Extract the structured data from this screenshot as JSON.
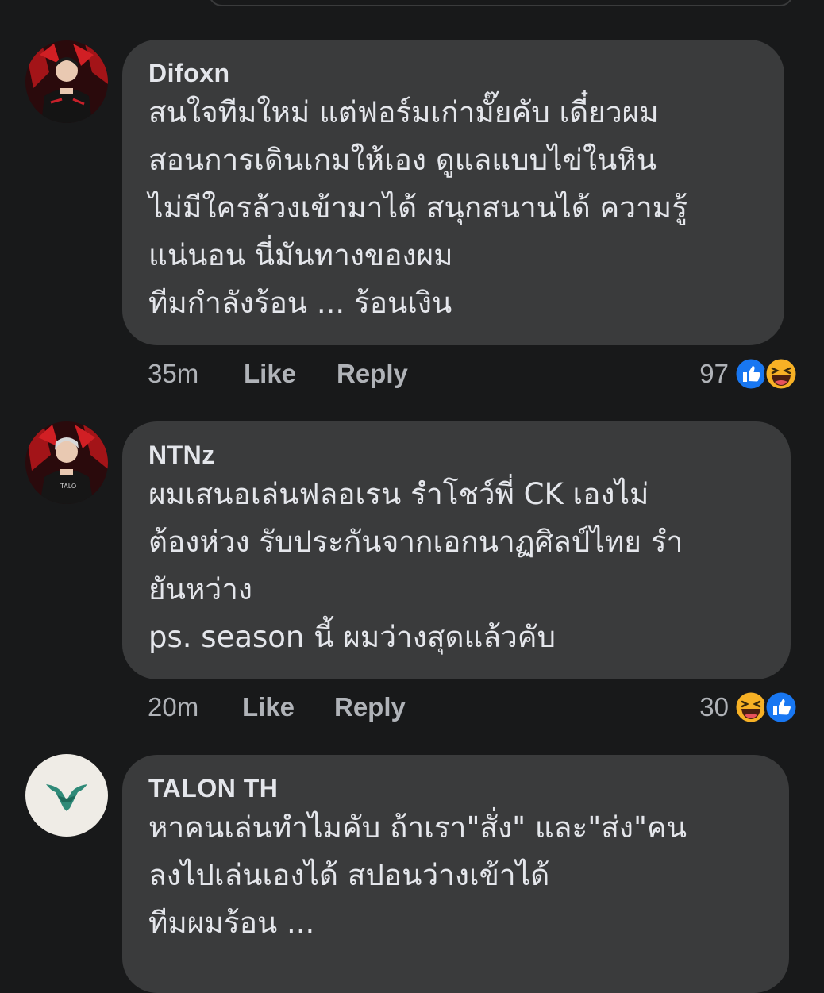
{
  "comments": [
    {
      "author": "Difoxn",
      "lines": [
        "สนใจทีมใหม่ แต่ฟอร์มเก่ามั๊ยคับ เดี๋ยวผม",
        "สอนการเดินเกมให้เอง ดูแลแบบไข่ในหิน",
        "ไม่มีใครล้วงเข้ามาได้ สนุกสนานได้ ความรู้",
        "แน่นอน นี่มันทางของผม",
        "ทีมกำลังร้อน ... ร้อนเงิน"
      ],
      "time": "35m",
      "like_label": "Like",
      "reply_label": "Reply",
      "reaction_count": "97",
      "reactions": [
        "like-icon",
        "haha-icon"
      ]
    },
    {
      "author": "NTNz",
      "lines": [
        "ผมเสนอเล่นฟลอเรน รำโชว์พี่ CK เองไม่",
        "ต้องห่วง รับประกันจากเอกนาฏศิลป์ไทย รำ",
        "ยันหว่าง",
        "ps. season นี้ ผมว่างสุดแล้วคับ"
      ],
      "time": "20m",
      "like_label": "Like",
      "reply_label": "Reply",
      "reaction_count": "30",
      "reactions": [
        "haha-icon",
        "like-icon"
      ]
    },
    {
      "author": "TALON TH",
      "lines": [
        "หาคนเล่นทำไมคับ ถ้าเรา\"สั่ง\" และ\"ส่ง\"คน",
        "ลงไปเล่นเองได้ สปอนว่างเข้าได้",
        "ทีมผมร้อน ..."
      ]
    }
  ],
  "colors": {
    "background": "#18191a",
    "bubble": "#3a3b3c",
    "text_primary": "#e4e6eb",
    "text_secondary": "#b0b3b8",
    "like_blue": "#1877f2",
    "haha_yellow": "#f7b125"
  }
}
